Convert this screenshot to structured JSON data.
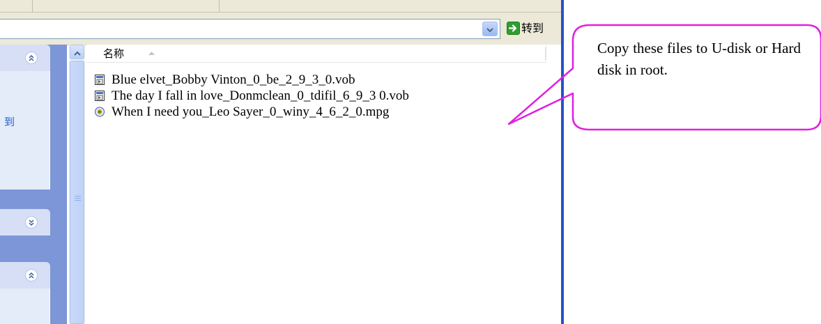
{
  "toolbar": {
    "visible": true
  },
  "address_bar": {
    "value": "",
    "dropdown_icon": "chevron-down-icon",
    "go_icon": "green-arrow-icon",
    "go_label": "转到"
  },
  "task_pane": {
    "section1": {
      "collapse_icon": "double-chevron-up-icon",
      "item_text": "到"
    },
    "section2": {
      "expand_icon": "double-chevron-down-icon"
    },
    "section3": {
      "collapse_icon": "double-chevron-up-icon"
    }
  },
  "file_list": {
    "column_name": "名称",
    "sort_icon": "sort-ascending-icon",
    "files": [
      {
        "name": "Blue elvet_Bobby Vinton_0_be_2_9_3_0.vob",
        "icon": "vob-file-icon"
      },
      {
        "name": "The day I fall in love_Donmclean_0_tdifil_6_9_3 0.vob",
        "icon": "vob-file-icon"
      },
      {
        "name": "When I need you_Leo Sayer_0_winy_4_6_2_0.mpg",
        "icon": "media-file-icon"
      }
    ]
  },
  "callout": {
    "text": "Copy these files to U-disk or Hard disk in root.",
    "border_color": "#e020e0"
  },
  "colors": {
    "task_pane_blue": "#7c96d8",
    "splitter_blue": "#2651c9",
    "link_blue": "#215dc6"
  }
}
